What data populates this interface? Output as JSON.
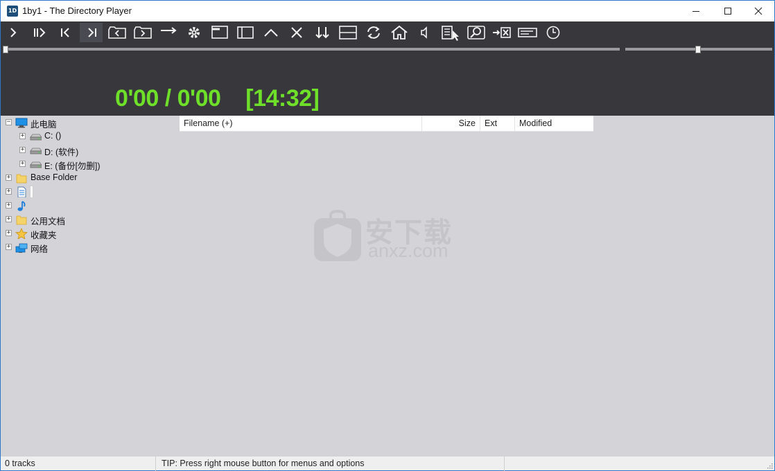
{
  "window": {
    "title": "1by1 - The Directory Player",
    "app_icon_text": "1D"
  },
  "toolbar": {
    "buttons": [
      {
        "name": "play-button",
        "icon": "play-icon"
      },
      {
        "name": "play-next-button",
        "icon": "play-next-icon"
      },
      {
        "name": "previous-button",
        "icon": "skip-back-icon"
      },
      {
        "name": "next-button",
        "icon": "skip-forward-icon",
        "active": true
      },
      {
        "name": "previous-folder-button",
        "icon": "folder-back-icon"
      },
      {
        "name": "next-folder-button",
        "icon": "folder-forward-icon"
      },
      {
        "name": "continue-button",
        "icon": "arrow-right-icon"
      },
      {
        "name": "settings-button",
        "icon": "gear-icon"
      },
      {
        "name": "window-layout-button",
        "icon": "window-layout-icon"
      },
      {
        "name": "tree-panel-button",
        "icon": "sidebar-panel-icon"
      },
      {
        "name": "up-button",
        "icon": "chevron-up-icon"
      },
      {
        "name": "stop-button",
        "icon": "close-x-icon"
      },
      {
        "name": "sort-button",
        "icon": "sort-down-icon"
      },
      {
        "name": "split-view-button",
        "icon": "split-view-icon"
      },
      {
        "name": "repeat-button",
        "icon": "refresh-icon"
      },
      {
        "name": "home-button",
        "icon": "home-icon"
      },
      {
        "name": "mute-button",
        "icon": "speaker-icon"
      },
      {
        "name": "playlist-select-button",
        "icon": "list-cursor-icon"
      },
      {
        "name": "search-button",
        "icon": "search-icon"
      },
      {
        "name": "remove-button",
        "icon": "remove-icon"
      },
      {
        "name": "info-button",
        "icon": "info-bar-icon"
      },
      {
        "name": "timer-button",
        "icon": "clock-icon"
      }
    ]
  },
  "player": {
    "time_display": "0'00 / 0'00    [14:32]",
    "seek_position": 0,
    "volume_level": 0.5
  },
  "tree": {
    "items": [
      {
        "label": "此电脑",
        "icon": "computer-icon",
        "expander": "−",
        "level": 0
      },
      {
        "label": "C: ()",
        "icon": "drive-icon",
        "expander": "+",
        "level": 1
      },
      {
        "label": "D: (软件)",
        "icon": "drive-icon",
        "expander": "+",
        "level": 1
      },
      {
        "label": "E: (备份[勿删])",
        "icon": "drive-icon",
        "expander": "+",
        "level": 1
      },
      {
        "label": "Base Folder",
        "icon": "folder-icon",
        "expander": "+",
        "level": 0
      },
      {
        "label": "",
        "icon": "document-icon",
        "expander": "+",
        "level": 0,
        "editing": true
      },
      {
        "label": "",
        "icon": "music-note-icon",
        "expander": "+",
        "level": 0
      },
      {
        "label": "公用文档",
        "icon": "folder-icon",
        "expander": "+",
        "level": 0
      },
      {
        "label": "收藏夹",
        "icon": "star-icon",
        "expander": "+",
        "level": 0
      },
      {
        "label": "网络",
        "icon": "network-icon",
        "expander": "+",
        "level": 0
      }
    ]
  },
  "file_list": {
    "columns": [
      "Filename (+)",
      "Size",
      "Ext",
      "Modified"
    ],
    "rows": []
  },
  "watermark": {
    "cn_text": "安下载",
    "en_text": "anxz.com",
    "shield_char": "安"
  },
  "statusbar": {
    "tracks": "0 tracks",
    "tip": "TIP: Press right mouse button for menus and options"
  }
}
